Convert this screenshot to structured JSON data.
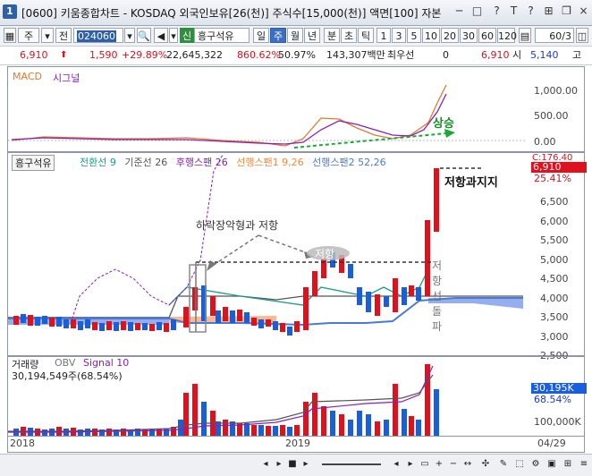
{
  "window": {
    "number": "1",
    "title": "[0600] 키움종합차트 - KOSDAQ 외국인보유[26(천)] 주식수[15,000(천)] 액면[100] 자본",
    "controls": [
      "─",
      "□",
      "?",
      "T",
      "?",
      "×"
    ]
  },
  "toolbar": {
    "market": "주",
    "range": "전",
    "code": "024060",
    "new_label": "신",
    "stock_name": "흥구석유",
    "periods": [
      "일",
      "주",
      "월",
      "년",
      "분",
      "초",
      "틱"
    ],
    "selected_period": "주",
    "intervals": [
      "1",
      "3",
      "5",
      "10",
      "20",
      "30",
      "60",
      "120"
    ],
    "count": "60/3"
  },
  "pricebar": {
    "price": "6,910",
    "change": "1,590",
    "change_pct": "+29.89%",
    "volume": "22,645,322",
    "vol_ratio": "860.62%",
    "turnover": "50.97%",
    "amount": "143,307백만",
    "best_label": "최우선",
    "best_value": "0",
    "ask_price": "6,910",
    "open_label": "시",
    "open_value": "5,140",
    "high_label": "고"
  },
  "macd": {
    "title": "MACD",
    "signal_label": "시그널",
    "axis": [
      "1,000.00",
      "500.00",
      "0.00"
    ],
    "annotation": "상승"
  },
  "price_panel": {
    "stock": "흥구석유",
    "legend": [
      {
        "text": "전환선 9",
        "color": "#1a9c8c"
      },
      {
        "text": "기준선 26",
        "color": "#555555"
      },
      {
        "text": "후행스팬 26",
        "color": "#8a1fb8"
      },
      {
        "text": "선행스팬1 9,26",
        "color": "#f08c40"
      },
      {
        "text": "선행스팬2 52,26",
        "color": "#4a7ad8"
      }
    ],
    "close_label": "C:176.40",
    "price_tag": "6,910",
    "pct_tag": "25.41%",
    "axis": [
      "6,500",
      "6,000",
      "5,500",
      "5,000",
      "4,500",
      "4,000",
      "3,500",
      "3,000",
      "2,500"
    ],
    "annotation_resistance_support": "저항과지지",
    "annotation_downtrend": "하락장악형과 저항",
    "annotation_resistance": "저항",
    "annotation_breakout": "저항선돌파"
  },
  "volume_panel": {
    "title": "거래량",
    "obv_label": "OBV",
    "signal_label": "Signal 10",
    "value": "30,194,549주(68.54%)",
    "tag_value": "30,195K",
    "tag_pct": "68.54%",
    "axis": [
      "100,000K"
    ]
  },
  "xaxis": {
    "labels": [
      "2018",
      "2019"
    ],
    "right_label": "04/29"
  },
  "colors": {
    "up": "#e0101c",
    "down": "#1a5ee0",
    "accent": "#2f5fa8"
  }
}
